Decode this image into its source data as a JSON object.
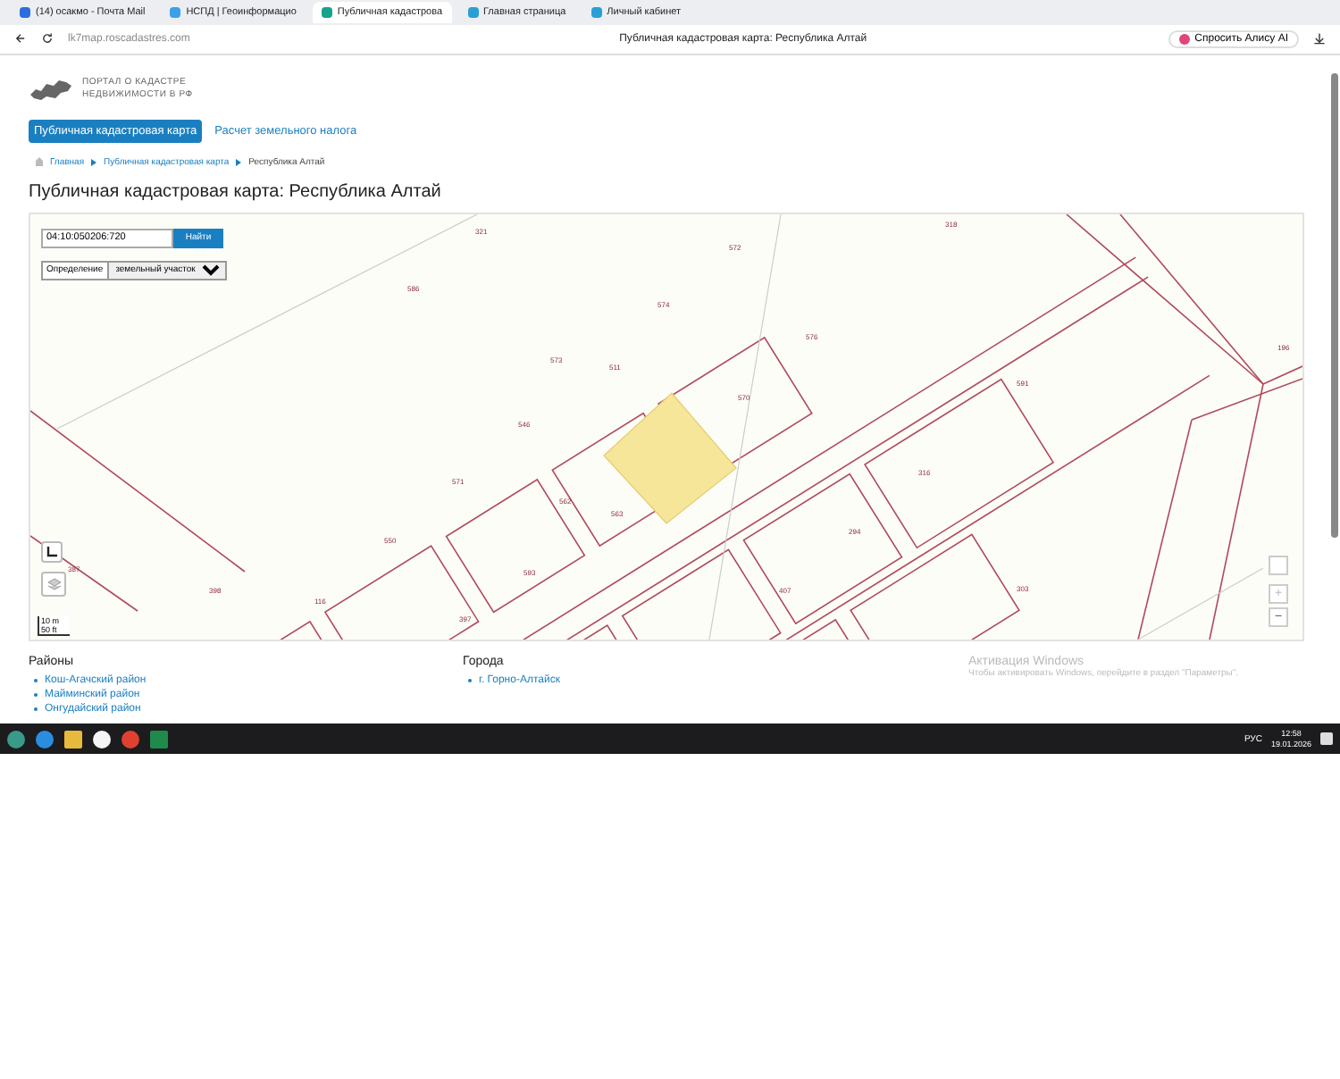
{
  "browser": {
    "tabs": [
      {
        "label": "(14) ocaкмо - Почта Mail",
        "selected": false
      },
      {
        "label": "НСПД | Геоинформацио",
        "selected": false
      },
      {
        "label": "Публичная кадастрова",
        "selected": true
      },
      {
        "label": "Главная страница",
        "selected": false
      },
      {
        "label": "Личный кабинет",
        "selected": false
      }
    ],
    "address": "lk7map.roscadastres.com",
    "page_title": "Публичная кадастровая карта: Республика Алтай",
    "assistant_button": "Спросить Алису AI"
  },
  "page": {
    "logo_lines": [
      "ПОРТАЛ О КАДАСТРЕ",
      "НЕДВИЖИМОСТИ В РФ"
    ],
    "nav": [
      {
        "label": "Публичная кадастровая карта",
        "selected": true
      },
      {
        "label": "Расчет земельного налога",
        "selected": false
      }
    ],
    "breadcrumbs": [
      "Главная",
      "Публичная кадастровая карта",
      "Республика Алтай"
    ],
    "heading": "Публичная кадастровая карта: Республика Алтай",
    "map": {
      "search_value": "04:10:050206:720",
      "search_button": "Найти",
      "mode_label": "Определение",
      "mode_value": "земельный участок",
      "scale": [
        "10 m",
        "50 ft"
      ],
      "zoom_in": "+",
      "zoom_out": "−",
      "parcels": [
        "321",
        "586",
        "572",
        "574",
        "576",
        "573",
        "511",
        "546",
        "571",
        "562",
        "563",
        "550",
        "593",
        "116",
        "398",
        "387",
        "397",
        "570",
        "318",
        "196",
        "591",
        "316",
        "294",
        "407",
        "303"
      ]
    },
    "districts": {
      "title": "Районы",
      "items": [
        "Кош-Агачский район",
        "Майминский район",
        "Онгудайский район"
      ]
    },
    "cities": {
      "title": "Города",
      "items": [
        "г. Горно-Алтайск"
      ]
    },
    "activation": {
      "title": "Активация Windows",
      "text": "Чтобы активировать Windows, перейдите в раздел \"Параметры\"."
    }
  },
  "taskbar": {
    "language": "РУС",
    "time": "12:58",
    "date": "19.01.2026"
  }
}
